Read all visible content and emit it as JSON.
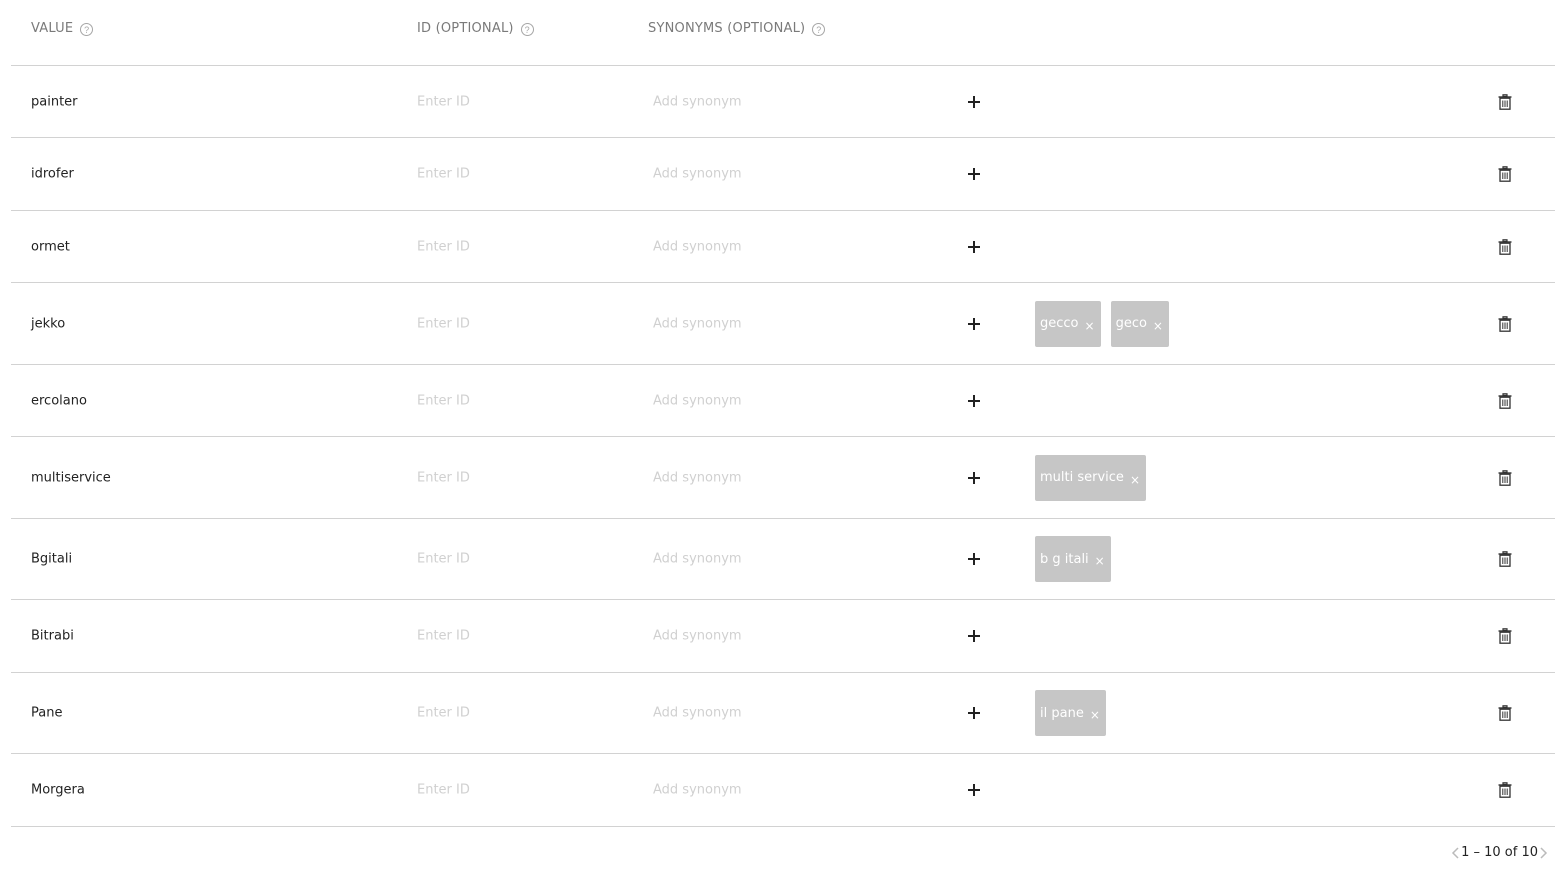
{
  "header": {
    "value_label": "VALUE",
    "id_label": "ID (OPTIONAL)",
    "synonyms_label": "SYNONYMS (OPTIONAL)",
    "help_glyph": "?"
  },
  "placeholders": {
    "id": "Enter ID",
    "synonym": "Add synonym"
  },
  "rows": [
    {
      "value": "painter",
      "synonyms": []
    },
    {
      "value": "idrofer",
      "synonyms": []
    },
    {
      "value": "ormet",
      "synonyms": []
    },
    {
      "value": "jekko",
      "synonyms": [
        "gecco",
        "geco"
      ]
    },
    {
      "value": "ercolano",
      "synonyms": []
    },
    {
      "value": "multiservice",
      "synonyms": [
        "multi service"
      ]
    },
    {
      "value": "Bgitali",
      "synonyms": [
        "b g itali"
      ]
    },
    {
      "value": "Bitrabi",
      "synonyms": []
    },
    {
      "value": "Pane",
      "synonyms": [
        "il pane"
      ]
    },
    {
      "value": "Morgera",
      "synonyms": []
    }
  ],
  "tag_remove_glyph": "×",
  "pagination": {
    "range_text": "1 – 10 of 10"
  },
  "icons": {
    "help": "help-icon",
    "add": "plus-icon",
    "delete": "trash-icon",
    "prev": "chevron-left-icon",
    "next": "chevron-right-icon"
  },
  "colors": {
    "tag_background": "#c6c6c6",
    "divider": "#d2d2d2",
    "placeholder": "#d0d0d0"
  }
}
